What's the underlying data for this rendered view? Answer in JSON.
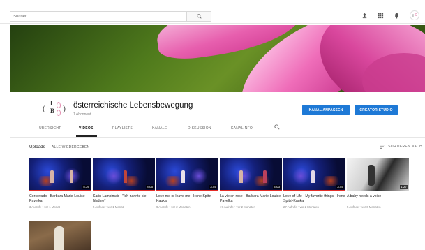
{
  "search": {
    "placeholder": "Suchen"
  },
  "top_icons": [
    "upload-icon",
    "apps-grid-icon",
    "bell-icon",
    "avatar"
  ],
  "channel": {
    "name": "österreichische Lebensbewegung",
    "subscribers": "1 Abonnent",
    "logo_letters": {
      "top": "L",
      "bottom": "B"
    },
    "buttons": {
      "customize": "KANAL ANPASSEN",
      "creator_studio": "CREATOR STUDIO"
    }
  },
  "tabs": [
    {
      "label": "ÜBERSICHT"
    },
    {
      "label": "VIDEOS"
    },
    {
      "label": "PLAYLISTS"
    },
    {
      "label": "KANÄLE"
    },
    {
      "label": "DISKUSSION"
    },
    {
      "label": "KANALINFO"
    }
  ],
  "uploads": {
    "title": "Uploads",
    "play_all": "ALLE WIEDERGEBEN",
    "sort_label": "SORTIEREN NACH"
  },
  "videos": [
    {
      "title": "Corcovado - Barbara Marie-Louise Pavelka",
      "meta": "3 Aufrufe • vor 1 Monat",
      "duration": "5:36"
    },
    {
      "title": "Karin Lampimair - \"Ich nannte sie Nadine\"",
      "meta": "5 Aufrufe • vor 1 Monat",
      "duration": "8:05"
    },
    {
      "title": "Love me or leave me - Irene Spitzl-Kaukal",
      "meta": "9 Aufrufe • vor 2 Monaten",
      "duration": "3:55"
    },
    {
      "title": "La vie en rose - Barbara Marie-Louise Pavelka",
      "meta": "17 Aufrufe • vor 2 Monaten",
      "duration": "4:03"
    },
    {
      "title": "Love of Life - My favorite things - Irene Spitzl-Kaukal",
      "meta": "27 Aufrufe • vor 2 Monaten",
      "duration": "3:55"
    },
    {
      "title": "A baby needs a voice",
      "meta": "5 Aufrufe • vor 6 Monaten",
      "duration": "1:27"
    }
  ],
  "colors": {
    "accent_blue": "#1e79d6",
    "progress_red": "#e52d27"
  }
}
